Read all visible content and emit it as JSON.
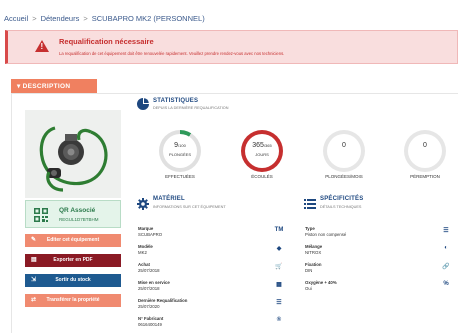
{
  "breadcrumb": {
    "home": "Accueil",
    "sep": ">",
    "holders": "Détendeurs",
    "current": "SCUBAPRO MK2 (PERSONNEL)"
  },
  "alert": {
    "title": "Requalification nécessaire",
    "message": "La requalification de cet équipement doit être renouvelée rapidement. Veuillez prendre rendez-vous avec nos techniciens."
  },
  "section": {
    "tab_label": "▾ DESCRIPTION"
  },
  "qr": {
    "title": "QR Associé",
    "code": "REGUL1D7BTBHM"
  },
  "actions": {
    "edit": "Editer cet équipement",
    "pdf": "Exporter en PDF",
    "stock": "Sortir du stock",
    "transfer": "Transférer la propriété"
  },
  "stats": {
    "title": "STATISTIQUES",
    "subtitle": "DEPUIS LA DERNIÈRE REQUALIFICATION",
    "gauges": [
      {
        "value": "9",
        "max": "/100",
        "unit": "PLONGÉES",
        "label": "EFFECTUÉES",
        "fraction": 0.09,
        "color": "#2f9a5a"
      },
      {
        "value": "365",
        "max": "/365",
        "unit": "JOURS",
        "label": "ÉCOULÉS",
        "fraction": 1.0,
        "color": "#c62f2f"
      },
      {
        "value": "0",
        "max": "",
        "unit": "",
        "label": "PLONGÉES/MOIS",
        "fraction": 0,
        "color": "#cccccc"
      },
      {
        "value": "0",
        "max": "",
        "unit": "",
        "label": "PÉREMPTION",
        "fraction": 0,
        "color": "#cccccc"
      }
    ]
  },
  "material": {
    "title": "MATÉRIEL",
    "subtitle": "INFORMATIONS SUR CET ÉQUIPEMENT",
    "fields": [
      {
        "label": "Marque",
        "value": "SCUBAPRO",
        "icon": "TM"
      },
      {
        "label": "Modèle",
        "value": "MK2",
        "icon": "◆"
      },
      {
        "label": "Achat",
        "value": "25/07/2018",
        "icon": "🛒"
      },
      {
        "label": "Mise en service",
        "value": "25/07/2018",
        "icon": "▦"
      },
      {
        "label": "Dernière Requalification",
        "value": "25/07/2020",
        "icon": "☰"
      },
      {
        "label": "N° Fabricant",
        "value": "0616400149",
        "icon": "®"
      }
    ]
  },
  "specs": {
    "title": "SPÉCIFICITÉS",
    "subtitle": "DÉTAILS TECHNIQUES",
    "fields": [
      {
        "label": "Type",
        "value": "Piston non compensé",
        "icon": "☰"
      },
      {
        "label": "Mélange",
        "value": "NITROX",
        "icon": "◐"
      },
      {
        "label": "Fixation",
        "value": "DIN",
        "icon": "🔗"
      },
      {
        "label": "Oxygène + 40%",
        "value": "Oui",
        "icon": "%"
      }
    ]
  },
  "colors": {
    "accent": "#f08060",
    "navy": "#1e4880",
    "danger": "#c62f2f",
    "success": "#2f9a5a"
  }
}
